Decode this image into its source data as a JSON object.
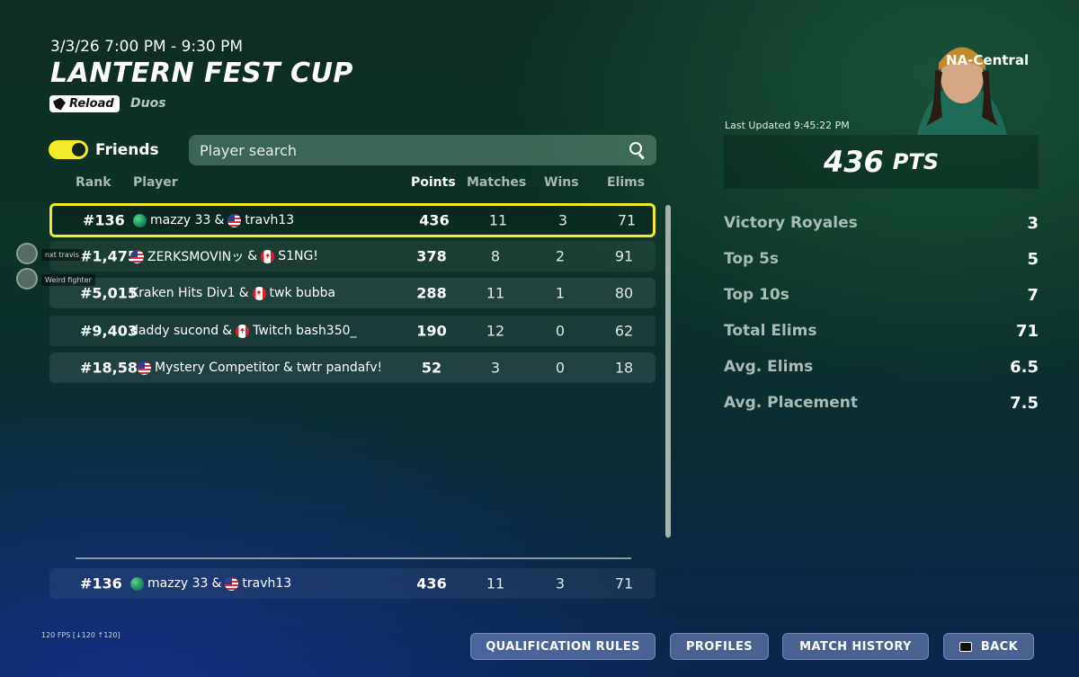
{
  "event": {
    "date_time": "3/3/26 7:00 PM - 9:30 PM",
    "title": "LANTERN FEST CUP",
    "mode_badge": "Reload",
    "mode_type": "Duos"
  },
  "filters": {
    "friends_label": "Friends",
    "friends_enabled": true,
    "search_placeholder": "Player search"
  },
  "table": {
    "headers": {
      "rank": "Rank",
      "player": "Player",
      "points": "Points",
      "matches": "Matches",
      "wins": "Wins",
      "elims": "Elims"
    },
    "rows": [
      {
        "rank": "#136",
        "flag1": "globe",
        "p1": "mazzy 33",
        "sep": "&",
        "flag2": "us",
        "p2": "travh13",
        "points": "436",
        "matches": "11",
        "wins": "3",
        "elims": "71",
        "selected": true
      },
      {
        "rank": "#1,475",
        "flag1": "us",
        "p1": "ZERKSMOVINッ",
        "sep": "&",
        "flag2": "ca",
        "p2": "S1NG!",
        "points": "378",
        "matches": "8",
        "wins": "2",
        "elims": "91"
      },
      {
        "rank": "#5,015",
        "flag1": "",
        "p1": "Kraken Hits Div1",
        "sep": "&",
        "flag2": "ca",
        "p2": "twk bubba",
        "points": "288",
        "matches": "11",
        "wins": "1",
        "elims": "80"
      },
      {
        "rank": "#9,403",
        "flag1": "",
        "p1": "daddy sucond",
        "sep": "&",
        "flag2": "ca",
        "p2": "Twitch bash350_",
        "points": "190",
        "matches": "12",
        "wins": "0",
        "elims": "62"
      },
      {
        "rank": "#18,586",
        "flag1": "us",
        "p1": "Mystery Competitor",
        "sep": "&",
        "flag2": "",
        "p2": "twtr pandafv!",
        "points": "52",
        "matches": "3",
        "wins": "0",
        "elims": "18"
      }
    ],
    "footer_row": {
      "rank": "#136",
      "flag1": "globe",
      "p1": "mazzy 33",
      "sep": "&",
      "flag2": "us",
      "p2": "travh13",
      "points": "436",
      "matches": "11",
      "wins": "3",
      "elims": "71"
    }
  },
  "side_friends": [
    {
      "label": "nxt travis"
    },
    {
      "label": "Weird fighter"
    }
  ],
  "summary": {
    "region": "NA-Central",
    "last_updated": "Last Updated 9:45:22 PM",
    "points": "436",
    "points_unit": "PTS",
    "stats": [
      {
        "label": "Victory Royales",
        "value": "3"
      },
      {
        "label": "Top 5s",
        "value": "5"
      },
      {
        "label": "Top 10s",
        "value": "7"
      },
      {
        "label": "Total Elims",
        "value": "71"
      },
      {
        "label": "Avg. Elims",
        "value": "6.5"
      },
      {
        "label": "Avg. Placement",
        "value": "7.5"
      }
    ]
  },
  "fps_text": "120 FPS [↓120 ↑120]",
  "buttons": {
    "qualification_rules": "QUALIFICATION RULES",
    "profiles": "PROFILES",
    "match_history": "MATCH HISTORY",
    "back": "BACK",
    "back_key": "ESC"
  },
  "colors": {
    "accent_yellow": "#f3ea2a",
    "button_bg": "#8c9fcf"
  }
}
